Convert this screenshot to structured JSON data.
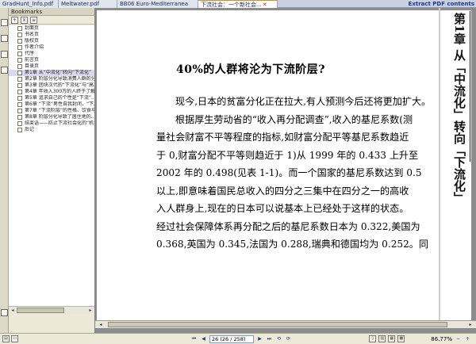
{
  "tabs": [
    {
      "label": "GradHunt_Info.pdf"
    },
    {
      "label": "Meltwater.pdf"
    },
    {
      "label": "BB06 Euro-Mediterranea"
    },
    {
      "label": "下流社会：一个新社会..."
    }
  ],
  "extract_link": "Extract PDF contents",
  "bookmarks": {
    "header": "Bookmarks",
    "items": [
      {
        "label": "封面页"
      },
      {
        "label": "书名页"
      },
      {
        "label": "版权页"
      },
      {
        "label": "作者介绍"
      },
      {
        "label": "代序"
      },
      {
        "label": "前言页"
      },
      {
        "label": "目录页"
      },
      {
        "label": "第1章  从“中流化”转向“下流化”"
      },
      {
        "label": "第2章  阶层分化导致消费人群的分..."
      },
      {
        "label": "第3章  团块次代的“下流化”与“高..."
      },
      {
        "label": "第4章  年收入300万的人终于了解..."
      },
      {
        "label": "第5章  追求自己的个性是“下流”..."
      },
      {
        "label": "第6章  “下流”男性自我封闭，“下..."
      },
      {
        "label": "第7章  “下流阶层”的性格、饮食与..."
      },
      {
        "label": "第8章  阶层分化导致了居住地的..."
      },
      {
        "label": "结束语——防止下流社会化的“机会..."
      },
      {
        "label": "后记"
      }
    ]
  },
  "document": {
    "side_title": "第1章  从「中流化」转向「下流化」",
    "heading": "40%的人群将沦为下流阶层?",
    "lines": [
      "现今,日本的贫富分化正在拉大,有人预测今后还将更加扩大。",
      "根据厚生劳动省的“收入再分配调查”,收入的基尼系数(测",
      "量社会财富不平等程度的指标,如财富分配平等基尼系数趋近",
      "于 0,财富分配不平等则趋近于 1)从 1999 年的 0.433 上升至",
      "2002 年的 0.498(见表 1-1)。而一个国家的基尼系数达到 0.5",
      "以上,即意味着国民总收入的四分之三集中在四分之一的高收",
      "入人群身上,现在的日本可以说基本上已经处于这样的状态。",
      "经过社会保障体系再分配之后的基尼系数日本为 0.322,美国为",
      "0.368,英国为 0.345,法国为 0.288,瑞典和德国均为 0.252。同"
    ]
  },
  "status": {
    "page_field": "26 (26 / 258)",
    "zoom": "86.77%"
  }
}
